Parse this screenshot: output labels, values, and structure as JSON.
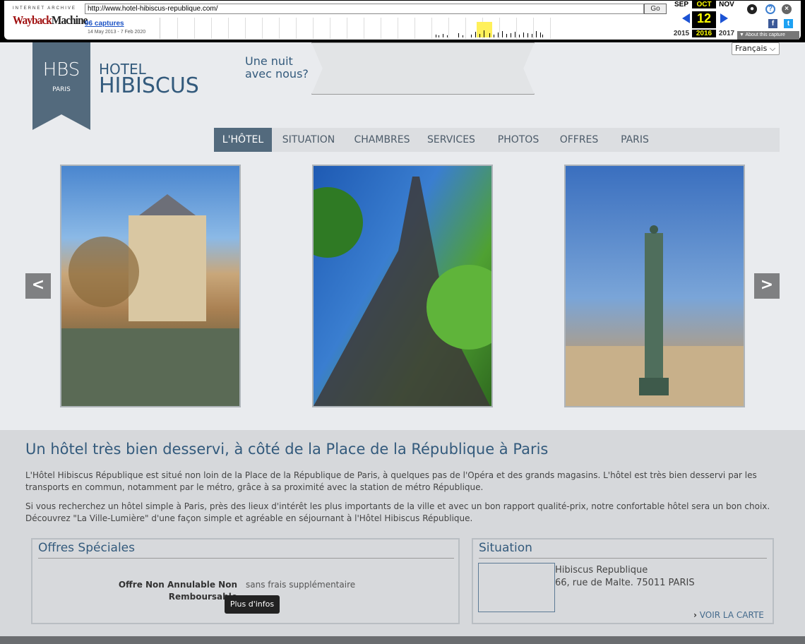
{
  "wayback": {
    "brand_top": "INTERNET ARCHIVE",
    "brand_logo_a": "Wayback",
    "brand_logo_b": "Machine",
    "url": "http://www.hotel-hibiscus-republique.com/",
    "go_label": "Go",
    "captures": "96 captures",
    "capture_range": "14 May 2013 - 7 Feb 2020",
    "months": [
      "SEP",
      "OCT",
      "NOV"
    ],
    "day": "12",
    "years": [
      "2015",
      "2016",
      "2017"
    ],
    "about_label": "▼ About this capture"
  },
  "language": "Français ⌵",
  "logo": {
    "hbs": "HBS",
    "paris": "PARIS",
    "hotel": "HOTEL",
    "name": "HIBISCUS"
  },
  "tagline": [
    "Une nuit",
    "avec nous?"
  ],
  "nav": [
    "L'HÔTEL",
    "SITUATION",
    "CHAMBRES",
    "SERVICES",
    "PHOTOS",
    "OFFRES",
    "PARIS"
  ],
  "carousel": {
    "prev_icon": "<",
    "next_icon": ">"
  },
  "intro": {
    "title": "Un hôtel très bien desservi, à côté de la Place de la République à Paris",
    "p1_line1": "L'Hôtel Hibiscus République est situé non loin de la Place de la République de Paris, à quelques pas de l'Opéra et des grands magasins. L'hôtel est très bien desservi par les",
    "p1_line2": "transports en commun, notamment par le métro, grâce à sa proximité avec la station de métro République.",
    "p2_line1": "Si vous recherchez un hôtel simple à Paris, près des lieux d'intérêt les plus importants de la ville et avec un bon rapport qualité-prix, notre confortable hôtel sera un bon choix.",
    "p2_line2": "Découvrez \"La Ville-Lumière\" d'une façon simple et agréable en séjournant à l'Hôtel Hibiscus République."
  },
  "offers": {
    "title": "Offres Spéciales",
    "name_line1": "Offre Non Annulable Non",
    "name_line2": "Remboursable",
    "desc": "sans frais supplémentaire",
    "tooltip": "Plus d'infos"
  },
  "situation": {
    "title": "Situation",
    "name": "Hibiscus Republique",
    "address": "66, rue de Malte. 75011 PARIS",
    "map_link": "VOIR LA CARTE"
  }
}
